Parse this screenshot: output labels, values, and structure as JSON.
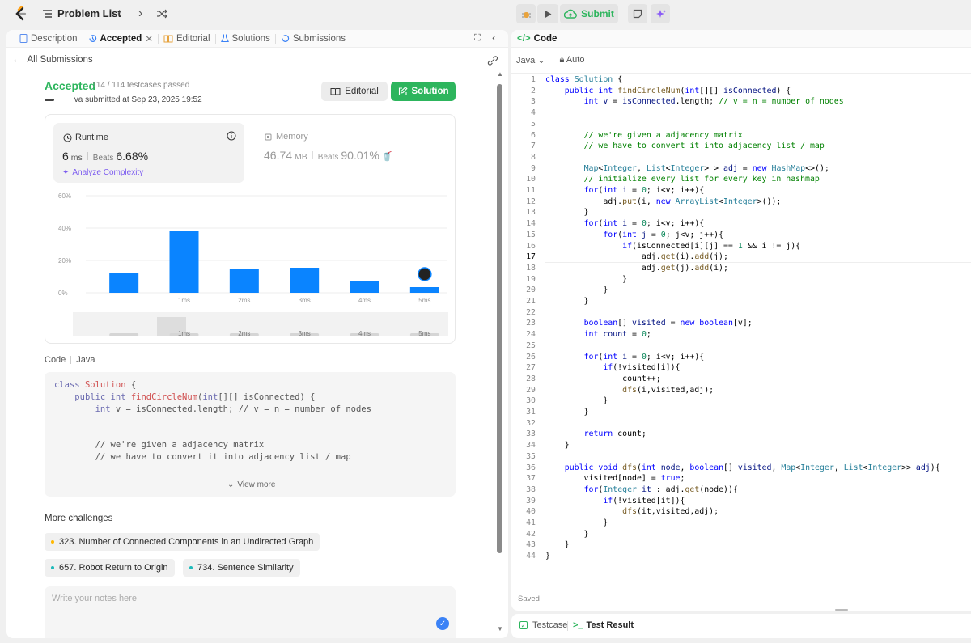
{
  "topbar": {
    "problem_list": "Problem List",
    "submit": "Submit"
  },
  "left": {
    "tabs": [
      {
        "label": "Description"
      },
      {
        "label": "Accepted"
      },
      {
        "label": "Editorial"
      },
      {
        "label": "Solutions"
      },
      {
        "label": "Submissions"
      }
    ],
    "back": "All Submissions",
    "status": "Accepted",
    "testcases": "114 / 114 testcases passed",
    "submitted_by": "va submitted at Sep 23, 2025 19:52",
    "editorial_btn": "Editorial",
    "solution_btn": "Solution",
    "runtime_label": "Runtime",
    "runtime_value": "6",
    "runtime_unit": "ms",
    "beats_label": "Beats",
    "runtime_beats": "6.68%",
    "analyze": "Analyze Complexity",
    "memory_label": "Memory",
    "memory_value": "46.74",
    "memory_unit": "MB",
    "memory_beats": "90.01%",
    "code_label": "Code",
    "code_lang": "Java",
    "code_lines": [
      "class Solution {",
      "    public int findCircleNum(int[][] isConnected) {",
      "        int v = isConnected.length; // v = n = number of nodes",
      "",
      "",
      "        // we're given a adjacency matrix",
      "        // we have to convert it into adjacency list / map"
    ],
    "view_more": "View more",
    "more_challenges": "More challenges",
    "challenges": [
      {
        "label": "323. Number of Connected Components in an Undirected Graph",
        "color": "#ffb800"
      },
      {
        "label": "657. Robot Return to Origin",
        "color": "#1cbaba"
      },
      {
        "label": "734. Sentence Similarity",
        "color": "#1cbaba"
      }
    ],
    "notes_placeholder": "Write your notes here"
  },
  "chart_data": {
    "type": "bar",
    "categories": [
      "",
      "1ms",
      "2ms",
      "3ms",
      "4ms",
      "5ms"
    ],
    "values": [
      12.5,
      38,
      14.5,
      15.5,
      7.5,
      3.5
    ],
    "ylabel_ticks": [
      "60%",
      "40%",
      "20%",
      "0%"
    ],
    "ylim": [
      0,
      60
    ],
    "bar_color": "#0a84ff",
    "highlight_index": 5
  },
  "right": {
    "code_tab": "Code",
    "lang": "Java",
    "auto": "Auto",
    "saved": "Saved",
    "testcase": "Testcase",
    "test_result": "Test Result"
  }
}
